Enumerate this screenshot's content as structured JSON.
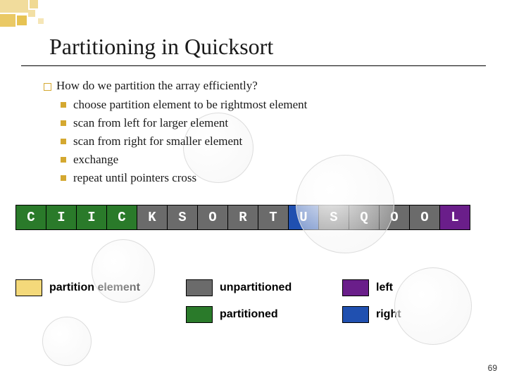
{
  "title": "Partitioning in Quicksort",
  "question": "How do we partition the array efficiently?",
  "steps": [
    "choose partition element to be rightmost element",
    "scan from left for larger element",
    "scan from right for smaller element",
    "exchange",
    "repeat until pointers cross"
  ],
  "array": [
    {
      "letter": "C",
      "class": "color-partitioned"
    },
    {
      "letter": "I",
      "class": "color-partitioned"
    },
    {
      "letter": "I",
      "class": "color-partitioned"
    },
    {
      "letter": "C",
      "class": "color-partitioned"
    },
    {
      "letter": "K",
      "class": "color-unpartitioned"
    },
    {
      "letter": "S",
      "class": "color-unpartitioned"
    },
    {
      "letter": "O",
      "class": "color-unpartitioned"
    },
    {
      "letter": "R",
      "class": "color-unpartitioned"
    },
    {
      "letter": "T",
      "class": "color-unpartitioned"
    },
    {
      "letter": "U",
      "class": "color-right"
    },
    {
      "letter": "S",
      "class": "color-unpartitioned"
    },
    {
      "letter": "Q",
      "class": "color-unpartitioned"
    },
    {
      "letter": "O",
      "class": "color-unpartitioned"
    },
    {
      "letter": "O",
      "class": "color-unpartitioned"
    },
    {
      "letter": "L",
      "class": "color-left"
    }
  ],
  "legend": {
    "row1": [
      {
        "class": "color-pe",
        "label": "partition element"
      },
      {
        "class": "color-unpartitioned",
        "label": "unpartitioned"
      },
      {
        "class": "color-left",
        "label": "left"
      }
    ],
    "row2": [
      {
        "class": "color-partitioned",
        "label": "partitioned"
      },
      {
        "class": "color-right",
        "label": "right"
      }
    ]
  },
  "page_number": "69",
  "colors": {
    "partitioned": "#2a7a2a",
    "unpartitioned": "#6b6b6b",
    "right": "#2050b0",
    "left": "#6a1e8a",
    "partition_element": "#f4d97a",
    "accent": "#d4a830"
  }
}
